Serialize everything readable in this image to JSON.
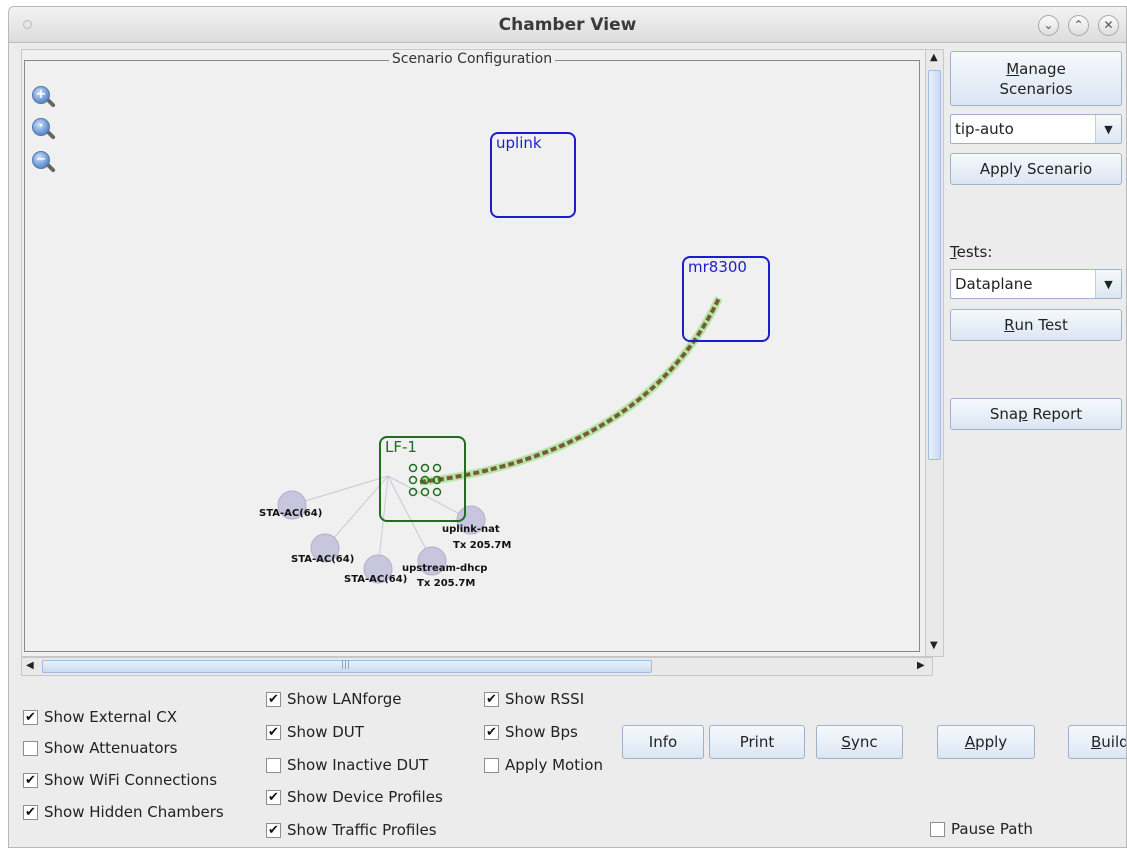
{
  "window": {
    "title": "Chamber View"
  },
  "scenario_panel": {
    "title": "Scenario Configuration",
    "nodes": {
      "uplink": "uplink",
      "mr8300": "mr8300",
      "lf1": "LF-1"
    },
    "stations": [
      {
        "label": "STA-AC(64)"
      },
      {
        "label": "STA-AC(64)"
      },
      {
        "label": "STA-AC(64)"
      }
    ],
    "uplink_nat": {
      "label": "uplink-nat",
      "tx": "Tx 205.7M"
    },
    "upstream_dhcp": {
      "label": "upstream-dhcp",
      "tx": "Tx 205.7M"
    }
  },
  "sidebar": {
    "manage_scenarios": "Manage Scenarios",
    "manage_mnemonic": "M",
    "manage_rest": "anage",
    "manage_line2": "Scenarios",
    "scenario_select": "tip-auto",
    "apply_scenario": "Apply Scenario",
    "tests_label_mnemonic": "T",
    "tests_label_rest": "ests:",
    "tests_select": "Dataplane",
    "run_test_mnemonic": "R",
    "run_test_rest": "un Test",
    "snap_report_pre": "Sna",
    "snap_report_mnemonic": "p",
    "snap_report_post": " Report"
  },
  "checkboxes": {
    "col1": [
      {
        "label": "Show External CX",
        "checked": true
      },
      {
        "label": "Show Attenuators",
        "checked": false
      },
      {
        "label": "Show WiFi Connections",
        "checked": true
      },
      {
        "label": "Show Hidden Chambers",
        "checked": true
      }
    ],
    "col2": [
      {
        "label": "Show LANforge",
        "checked": true
      },
      {
        "label": "Show DUT",
        "checked": true
      },
      {
        "label": "Show Inactive DUT",
        "checked": false
      },
      {
        "label": "Show Device Profiles",
        "checked": true
      },
      {
        "label": "Show Traffic Profiles",
        "checked": true
      }
    ],
    "col3": [
      {
        "label": "Show RSSI",
        "checked": true
      },
      {
        "label": "Show Bps",
        "checked": true
      },
      {
        "label": "Apply Motion",
        "checked": false
      }
    ],
    "pause_path": {
      "label": "Pause Path",
      "checked": false
    }
  },
  "bottom_buttons": {
    "info": "Info",
    "print": "Print",
    "sync_mnemonic": "S",
    "sync_rest": "ync",
    "apply_mnemonic": "A",
    "apply_rest": "pply",
    "build_mnemonic": "B",
    "build_rest": "uild"
  },
  "check_mark": "✔",
  "hscroll_grip": "|||",
  "titlebar_buttons": {
    "minimize": "⌄",
    "maximize": "⌃",
    "close": "✕"
  },
  "scroll_arrows": {
    "up": "▲",
    "down": "▼",
    "left": "◀",
    "right": "▶"
  },
  "zoom_glyphs": {
    "zoom_in": "+",
    "zoom_fit": "·",
    "zoom_out": "−"
  },
  "dropdown_glyph": "▼",
  "colors": {
    "dut_blue": "#1d1dcf",
    "lanforge_green": "#1e6e1e",
    "link_brown": "#7a5a3a",
    "link_glow": "#b5e6a6",
    "station_fill": "#c8c6de"
  }
}
